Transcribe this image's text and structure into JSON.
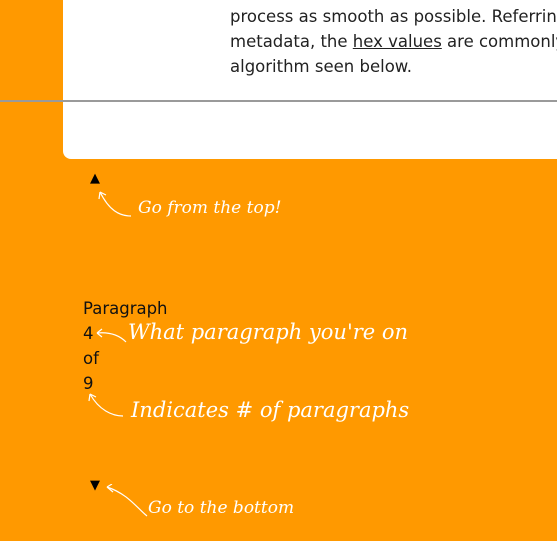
{
  "article": {
    "line1": "process as smooth as possible. Referring",
    "line2_before": "metadata, the ",
    "line2_link": "hex values",
    "line2_after": " are commonly",
    "line3": "algorithm seen below."
  },
  "controls": {
    "top_arrow": "▲",
    "bottom_arrow": "▼"
  },
  "indicator": {
    "label": "Paragraph",
    "current": "4",
    "of_label": "of",
    "total": "9"
  },
  "annotations": {
    "top_note": "Go from the top!",
    "current_note": "What paragraph you're on",
    "total_note": "Indicates # of paragraphs",
    "bottom_note": "Go to the bottom"
  },
  "colors": {
    "background": "#FF9900",
    "card": "#FFFFFF",
    "annotation": "#FFFFFF"
  }
}
